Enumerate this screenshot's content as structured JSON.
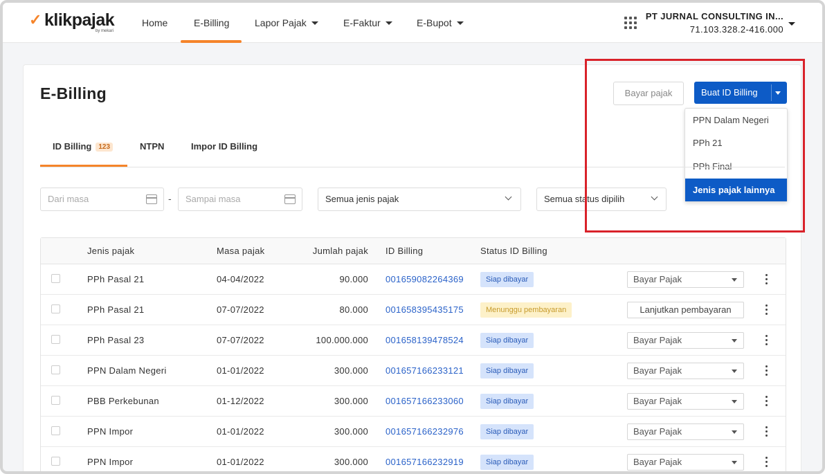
{
  "brand": {
    "name": "klikpajak",
    "by": "by mekari",
    "accent": "#f5842a",
    "primary": "#0d5bc6"
  },
  "nav": {
    "items": [
      {
        "label": "Home",
        "has_caret": false
      },
      {
        "label": "E-Billing",
        "has_caret": false,
        "active": true
      },
      {
        "label": "Lapor Pajak",
        "has_caret": true
      },
      {
        "label": "E-Faktur",
        "has_caret": true
      },
      {
        "label": "E-Bupot",
        "has_caret": true
      }
    ]
  },
  "company": {
    "name": "PT JURNAL CONSULTING IN...",
    "npwp": "71.103.328.2-416.000"
  },
  "page": {
    "title": "E-Billing",
    "bayar_button": "Bayar pajak",
    "buat_button": "Buat ID Billing",
    "menu": [
      "PPN Dalam Negeri",
      "PPh 21",
      "PPh Final",
      "Jenis pajak lainnya"
    ],
    "menu_selected": "Jenis pajak lainnya"
  },
  "tabs": [
    {
      "label": "ID Billing",
      "badge": "123",
      "active": true
    },
    {
      "label": "NTPN"
    },
    {
      "label": "Impor ID Billing"
    }
  ],
  "filters": {
    "dari_placeholder": "Dari masa",
    "sampai_placeholder": "Sampai masa",
    "dash": "-",
    "jenis": "Semua jenis pajak",
    "status": "Semua status dipilih"
  },
  "table": {
    "headers": [
      "Jenis pajak",
      "Masa pajak",
      "Jumlah pajak",
      "ID Billing",
      "Status ID Billing"
    ],
    "rows": [
      {
        "jenis": "PPh Pasal 21",
        "masa": "04-04/2022",
        "jumlah": "90.000",
        "id": "001659082264369",
        "status": "Siap dibayar",
        "status_kind": "ready",
        "action": "Bayar Pajak",
        "action_kind": "select"
      },
      {
        "jenis": "PPh Pasal 21",
        "masa": "07-07/2022",
        "jumlah": "80.000",
        "id": "001658395435175",
        "status": "Menunggu pembayaran",
        "status_kind": "wait",
        "action": "Lanjutkan pembayaran",
        "action_kind": "button"
      },
      {
        "jenis": "PPh Pasal 23",
        "masa": "07-07/2022",
        "jumlah": "100.000.000",
        "id": "001658139478524",
        "status": "Siap dibayar",
        "status_kind": "ready",
        "action": "Bayar Pajak",
        "action_kind": "select"
      },
      {
        "jenis": "PPN Dalam Negeri",
        "masa": "01-01/2022",
        "jumlah": "300.000",
        "id": "001657166233121",
        "status": "Siap dibayar",
        "status_kind": "ready",
        "action": "Bayar Pajak",
        "action_kind": "select"
      },
      {
        "jenis": "PBB Perkebunan",
        "masa": "01-12/2022",
        "jumlah": "300.000",
        "id": "001657166233060",
        "status": "Siap dibayar",
        "status_kind": "ready",
        "action": "Bayar Pajak",
        "action_kind": "select"
      },
      {
        "jenis": "PPN Impor",
        "masa": "01-01/2022",
        "jumlah": "300.000",
        "id": "001657166232976",
        "status": "Siap dibayar",
        "status_kind": "ready",
        "action": "Bayar Pajak",
        "action_kind": "select"
      },
      {
        "jenis": "PPN Impor",
        "masa": "01-01/2022",
        "jumlah": "300.000",
        "id": "001657166232919",
        "status": "Siap dibayar",
        "status_kind": "ready",
        "action": "Bayar Pajak",
        "action_kind": "select"
      }
    ]
  }
}
